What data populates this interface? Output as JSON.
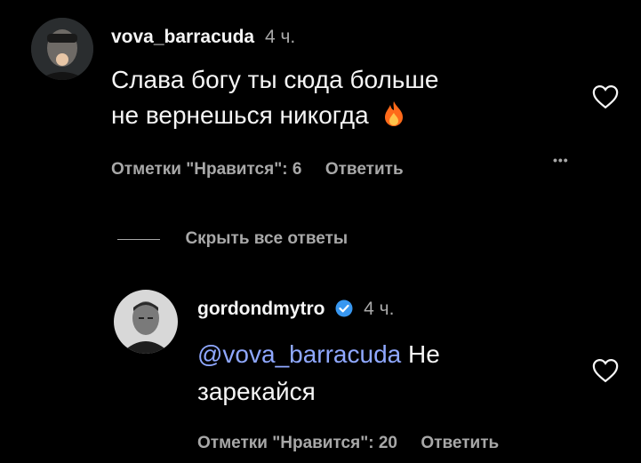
{
  "comment": {
    "username": "vova_barracuda",
    "time": "4 ч.",
    "text_line1": "Слава богу ты сюда больше",
    "text_line2": "не вернешься никогда",
    "emoji": "🔥",
    "likes_label": "Отметки \"Нравится\": 6",
    "reply_label": "Ответить",
    "more_label": "•••"
  },
  "replies_toggle": {
    "label": "Скрыть все ответы"
  },
  "reply": {
    "username": "gordondmytro",
    "time": "4 ч.",
    "mention": "@vova_barracuda",
    "text_after_mention": " Не",
    "text_line2": "зарекайся",
    "likes_label": "Отметки \"Нравится\": 20",
    "reply_label": "Ответить"
  },
  "colors": {
    "background": "#000000",
    "text": "#f5f5f5",
    "secondary": "#a8a8a8",
    "mention": "#8fa8ff",
    "verified": "#3897f0",
    "flame": "#ff6a1a"
  },
  "icons": [
    "avatar",
    "heart-icon",
    "more-icon",
    "verified-badge-icon",
    "fire-emoji"
  ]
}
